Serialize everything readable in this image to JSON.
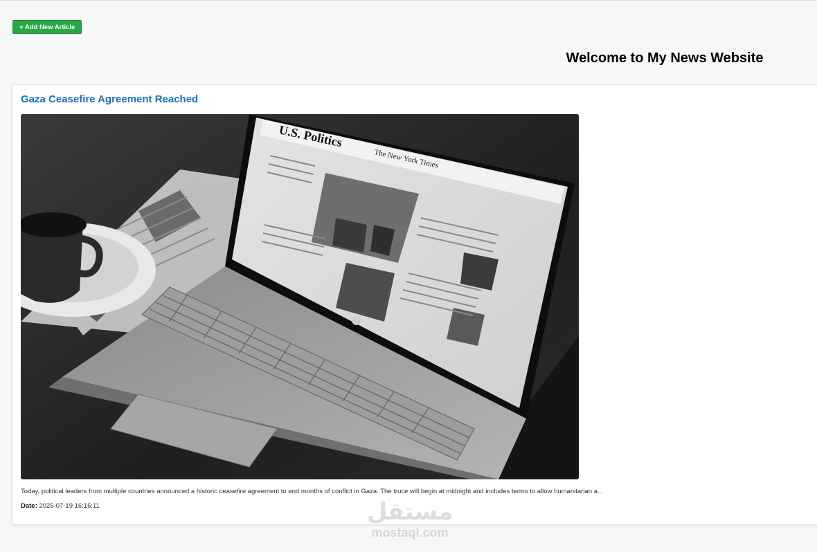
{
  "toolbar": {
    "add_article_label": "+ Add New Article"
  },
  "header": {
    "title": "Welcome to My News Website"
  },
  "articles": [
    {
      "title": "Gaza Ceasefire Agreement Reached",
      "image_alt": "Laptop showing U.S. Politics news page next to newspapers and a coffee cup",
      "excerpt": "Today, political leaders from multiple countries announced a historic ceasefire agreement to end months of conflict in Gaza. The truce will begin at midnight and includes terms to allow humanitarian a...",
      "date_label": "Date:",
      "date_value": "2025-07-19 16:16:11"
    }
  ],
  "watermark": {
    "arabic": "مستقل",
    "latin": "mostaql.com"
  },
  "colors": {
    "accent_green": "#28a745",
    "link_blue": "#1a6fc4",
    "page_background": "#f7f7f7"
  }
}
